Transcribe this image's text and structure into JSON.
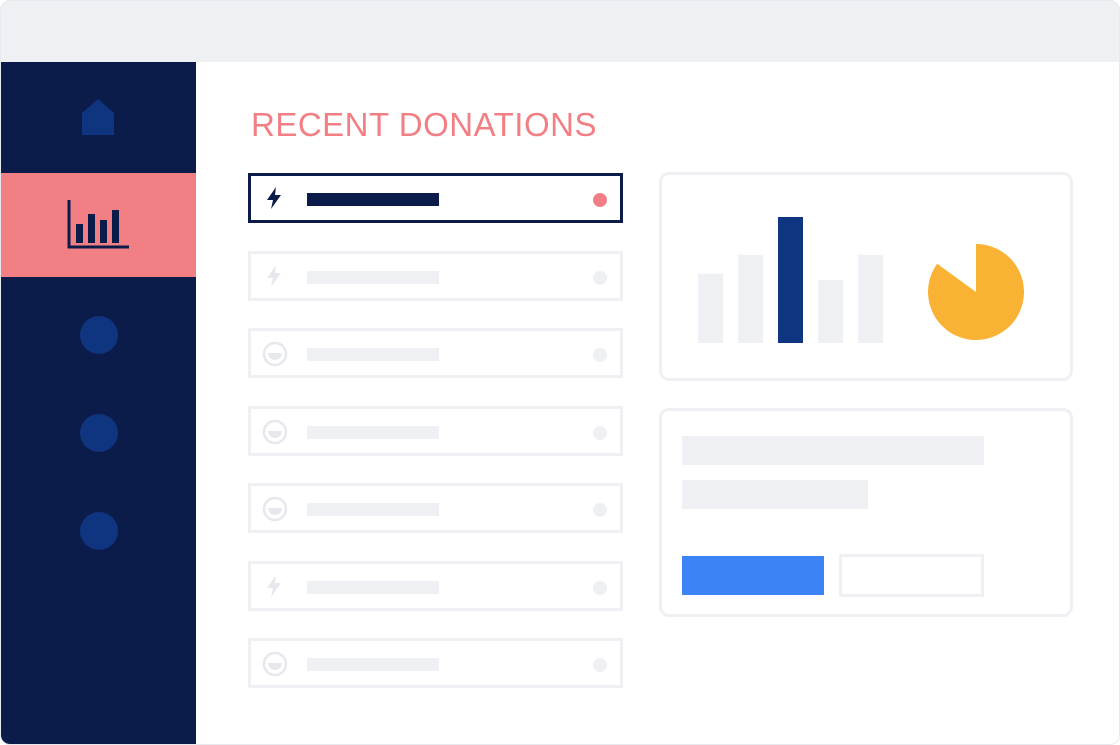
{
  "header": {
    "title": "RECENT DONATIONS"
  },
  "sidebar": {
    "items": [
      {
        "name": "home",
        "icon": "home-icon",
        "active": false
      },
      {
        "name": "reports",
        "icon": "bar-chart-icon",
        "active": true
      },
      {
        "name": "item-3",
        "icon": "circle-icon",
        "active": false
      },
      {
        "name": "item-4",
        "icon": "circle-icon",
        "active": false
      },
      {
        "name": "item-5",
        "icon": "circle-icon",
        "active": false
      }
    ]
  },
  "donations": [
    {
      "icon": "lightning-icon",
      "selected": true
    },
    {
      "icon": "lightning-icon",
      "selected": false
    },
    {
      "icon": "coin-icon",
      "selected": false
    },
    {
      "icon": "coin-icon",
      "selected": false
    },
    {
      "icon": "coin-icon",
      "selected": false
    },
    {
      "icon": "lightning-icon",
      "selected": false
    },
    {
      "icon": "coin-icon",
      "selected": false
    }
  ],
  "summary_chart": {
    "bars": [
      0.55,
      0.7,
      1.0,
      0.5,
      0.7
    ],
    "highlighted_bar_index": 2,
    "pie_filled_fraction": 0.85
  },
  "colors": {
    "sidebar_bg": "#0b1c4b",
    "sidebar_active": "#f27f84",
    "heading": "#f27f84",
    "accent_blue": "#0f3580",
    "button_blue": "#3c83f6",
    "pie": "#f9b233",
    "placeholder": "#eff0f4"
  }
}
